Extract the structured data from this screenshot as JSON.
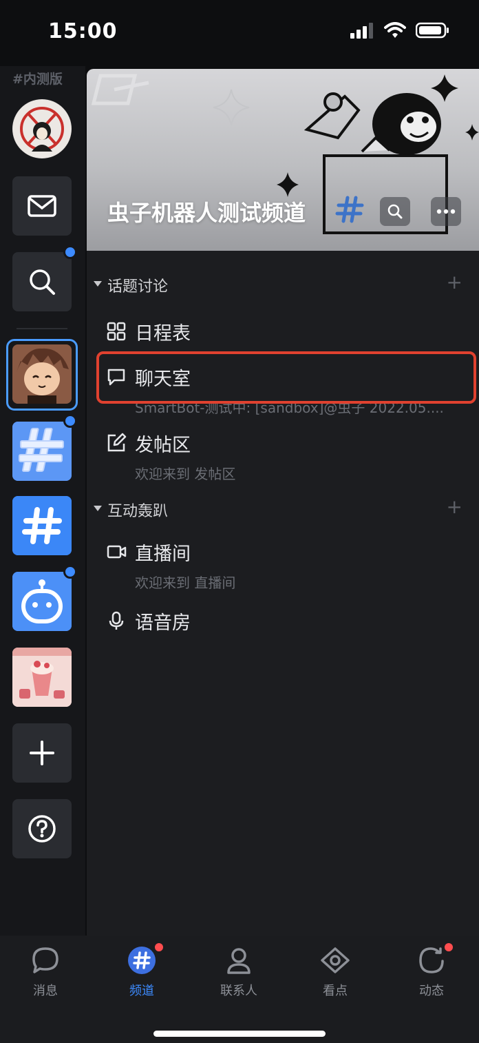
{
  "status_bar": {
    "time": "15:00",
    "signal_icon": "cellular-signal-icon",
    "wifi_icon": "wifi-icon",
    "battery_icon": "battery-icon"
  },
  "rail": {
    "beta_tag": "#内测版",
    "items": [
      {
        "name": "anonymous-avatar"
      },
      {
        "name": "mail-icon"
      },
      {
        "name": "search-icon",
        "has_dot": true
      },
      {
        "name": "anime-avatar",
        "selected": true
      },
      {
        "name": "hashtag-3d",
        "has_dot": true
      },
      {
        "name": "hashtag-blue"
      },
      {
        "name": "robot-icon",
        "has_dot": true
      },
      {
        "name": "dessert-thumbnail"
      },
      {
        "name": "add-icon"
      },
      {
        "name": "help-icon"
      }
    ]
  },
  "channel": {
    "title": "虫子机器人测试频道",
    "sections": [
      {
        "label": "话题讨论",
        "items": [
          {
            "name": "日程表",
            "icon": "schedule-grid-icon"
          },
          {
            "name": "聊天室",
            "icon": "chat-bubble-icon",
            "subtitle": "SmartBot-测试中: [sandbox]@虫子  2022.05...."
          },
          {
            "name": "发帖区",
            "icon": "edit-post-icon",
            "subtitle": "欢迎来到 发帖区"
          }
        ]
      },
      {
        "label": "互动轰趴",
        "items": [
          {
            "name": "直播间",
            "icon": "video-camera-icon",
            "subtitle": "欢迎来到 直播间"
          },
          {
            "name": "语音房",
            "icon": "microphone-icon"
          }
        ]
      }
    ]
  },
  "tabbar": {
    "tabs": [
      {
        "label": "消息",
        "icon": "message-bubble-icon",
        "active": false,
        "badge": false
      },
      {
        "label": "频道",
        "icon": "channel-hashtag-icon",
        "active": true,
        "badge": true
      },
      {
        "label": "联系人",
        "icon": "contact-person-icon",
        "active": false,
        "badge": false
      },
      {
        "label": "看点",
        "icon": "eye-icon",
        "active": false,
        "badge": false
      },
      {
        "label": "动态",
        "icon": "activity-refresh-icon",
        "active": false,
        "badge": true
      }
    ]
  },
  "colors": {
    "accent": "#3d8bff",
    "highlight": "#e0412f",
    "badge": "#ff4d4f",
    "panel": "#1c1d20"
  }
}
